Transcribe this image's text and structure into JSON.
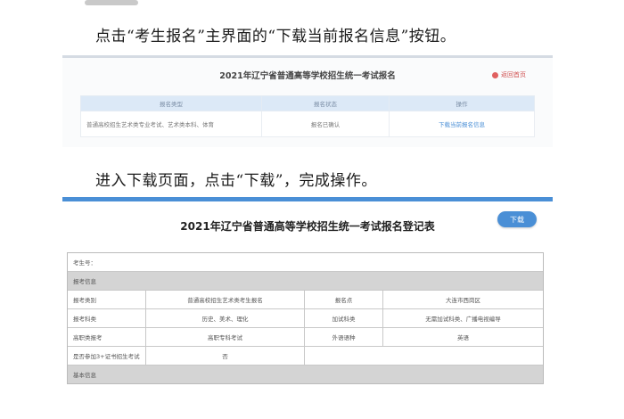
{
  "instructions": {
    "step1": "点击“考生报名”主界面的“下载当前报名信息”按钮。",
    "step2": "进入下载页面，点击“下载”，完成操作。"
  },
  "panel1": {
    "title": "2021年辽宁省普通高等学校招生统一考试报名",
    "top_right_link": "返回首页",
    "table": {
      "headers": [
        "报名类型",
        "报名状态",
        "操作"
      ],
      "row": [
        "普通高校招生艺术类专业考试、艺术类本科、体育",
        "报名已确认",
        "下载当前报名信息"
      ]
    }
  },
  "panel2": {
    "title": "2021年辽宁省普通高等学校招生统一考试报名登记表",
    "download_button": "下载",
    "exam_no_label": "考生号：",
    "section_basic": "报考信息",
    "rows": [
      [
        "报考类别",
        "普通高校招生艺术类考生报名",
        "报名点",
        "大连市西岗区"
      ],
      [
        "报考科类",
        "历史、美术、理化",
        "加试科类",
        "无需加试科类、广播电视编导"
      ],
      [
        "高职类报考",
        "高职专科考试",
        "外语语种",
        "英语"
      ],
      [
        "是否参加3+证书招生考试",
        "否",
        "",
        ""
      ]
    ],
    "section_base": "基本信息"
  }
}
